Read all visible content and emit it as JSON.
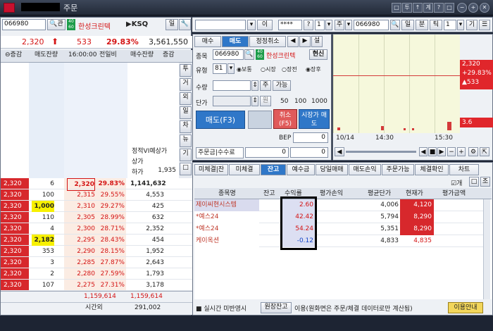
{
  "window": {
    "title": "주문",
    "buttons": [
      "□",
      "투",
      "↑",
      "계",
      "?",
      "□",
      "−",
      "+",
      "✕"
    ]
  },
  "left": {
    "code": "066980",
    "mag": "관",
    "grade_top": "40",
    "grade_bottom": "60",
    "name": "한성크린텍",
    "ksq": "KSQ",
    "btn1": "일",
    "btn2": "🔧",
    "price": "2,320",
    "arrow": "⬆",
    "change": "533",
    "rate": "29.83%",
    "volume": "3,561,550",
    "headers": [
      "증감",
      "매도잔량",
      "16:00:00",
      "전일비",
      "매수잔량",
      "증감"
    ],
    "side_btns": [
      "투",
      "거",
      "외",
      "일",
      "차",
      "뉴",
      "기",
      "□"
    ],
    "static_info": [
      {
        "label": "정적VI예상가",
        "value": ""
      },
      {
        "label": "상가",
        "value": ""
      },
      {
        "label": "하가",
        "value": "1,935"
      }
    ],
    "asks": [
      {
        "qty": "",
        "price": "",
        "rate": ""
      }
    ],
    "bids": [
      {
        "qty": "6",
        "price": "2,320",
        "rate": "29.83%",
        "bidqty": "1,141,632",
        "flag": "▲"
      },
      {
        "qty": "100",
        "price": "2,315",
        "rate": "29.55%",
        "bidqty": "4,553"
      },
      {
        "qty": "1,000",
        "price": "2,310",
        "rate": "29.27%",
        "bidqty": "425"
      },
      {
        "qty": "110",
        "price": "2,305",
        "rate": "28.99%",
        "bidqty": "632"
      },
      {
        "qty": "4",
        "price": "2,300",
        "rate": "28.71%",
        "bidqty": "2,352"
      },
      {
        "qty": "2,182",
        "price": "2,295",
        "rate": "28.43%",
        "bidqty": "454"
      },
      {
        "qty": "353",
        "price": "2,290",
        "rate": "28.15%",
        "bidqty": "1,952"
      },
      {
        "qty": "3",
        "price": "2,285",
        "rate": "27.87%",
        "bidqty": "2,643"
      },
      {
        "qty": "2",
        "price": "2,280",
        "rate": "27.59%",
        "bidqty": "1,793"
      },
      {
        "qty": "107",
        "price": "2,275",
        "rate": "27.31%",
        "bidqty": "3,178"
      }
    ],
    "left_prices": [
      "2,320",
      "2,320",
      "2,320",
      "2,320",
      "2,320",
      "2,320",
      "2,320",
      "2,320",
      "2,320",
      "2,320"
    ],
    "total_ask": "1,159,614",
    "total_bid": "1,159,614",
    "after_label": "시간외",
    "after_value": "291,002"
  },
  "order": {
    "tabs": [
      "매수",
      "매도",
      "정정취소"
    ],
    "arrows": [
      "◀",
      "▶",
      "설"
    ],
    "code_label": "종목",
    "code": "066980",
    "name": "한성크린텍",
    "cash": "현신",
    "type_label": "유형",
    "type_code": "81",
    "radios": [
      "보통",
      "시장",
      "장전",
      "장후"
    ],
    "qty_label": "수량",
    "qty_btn": "주",
    "avail": "가능",
    "price_label": "단가",
    "price_btn": "원",
    "quick": [
      "50",
      "100",
      "1000"
    ],
    "sell_btn": "매도(F3)",
    "cancel_btn": "취소(F5)",
    "market_btn": "시장가 매도",
    "bep_label": "BEP",
    "bep_val": "0",
    "margin_label": "주문금|수수료",
    "margin_val": "0",
    "margin_val2": "0"
  },
  "top_right": {
    "search_val": "",
    "mode": "이",
    "pw": "****",
    "q": "?",
    "n": "1",
    "tab_label": "주",
    "code": "066980",
    "btns": [
      "일",
      "분",
      "틱",
      "1",
      "기"
    ],
    "x_labels": [
      "10/14",
      "14:30",
      "15:30"
    ],
    "price_tag": "2,320",
    "rate_tag": "+29.83%",
    "chg_tag": "▲533",
    "low_tag": "3.6"
  },
  "balance": {
    "tabs": [
      "미체결|잔",
      "미체결",
      "잔고",
      "예수금",
      "당일매매",
      "매도손익",
      "주문가능",
      "체결확인",
      "차트"
    ],
    "active": "잔고",
    "checks": [
      "개",
      "□",
      "조"
    ],
    "headers": [
      "종목명",
      "잔고",
      "수익률",
      "평가손익",
      "평균단가",
      "현재가",
      "평가금액"
    ],
    "rows": [
      {
        "name": "제이씨현시스템",
        "qty": "",
        "rate": "2.60",
        "profit": "",
        "avg": "4,006",
        "cur": "4,120",
        "eval": ""
      },
      {
        "name": "*예스24",
        "qty": "",
        "rate": "42.42",
        "profit": "",
        "avg": "5,794",
        "cur": "8,290",
        "eval": ""
      },
      {
        "name": "*예스24",
        "qty": "",
        "rate": "54.24",
        "profit": "",
        "avg": "5,351",
        "cur": "8,290",
        "eval": ""
      },
      {
        "name": "케이옥션",
        "qty": "",
        "rate": "-0.12",
        "profit": "",
        "avg": "4,833",
        "cur": "4,835",
        "eval": ""
      }
    ],
    "footer_flag": "실시간 미반영시",
    "footer_btn": "원장잔고",
    "footer_note": "이용(원화면은 주문/체결 데이터로만 계산됨)",
    "footer_help": "이용안내"
  }
}
